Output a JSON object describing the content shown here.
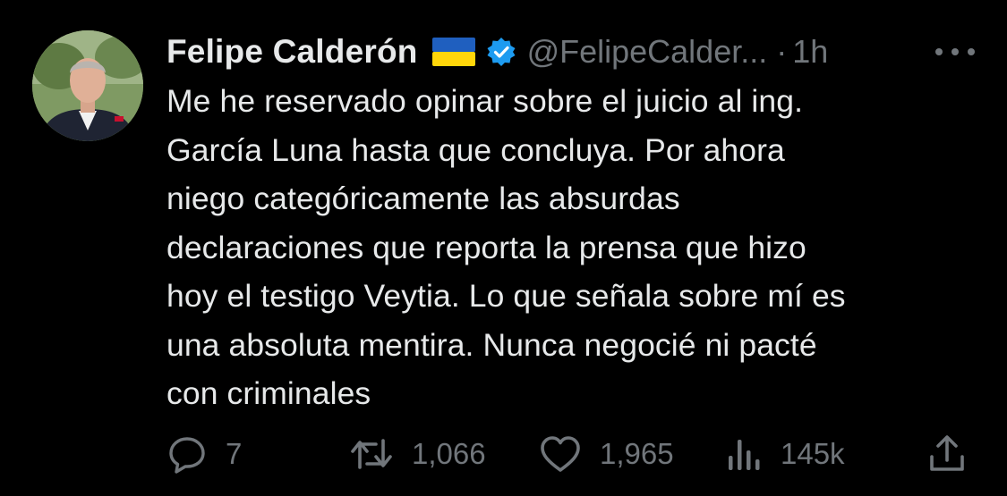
{
  "tweet": {
    "author_name": "Felipe Calderón",
    "handle": "@FelipeCalder...",
    "separator": "·",
    "time": "1h",
    "text": "Me he reservado opinar sobre el juicio al ing.\nGarcía Luna hasta que concluya. Por ahora\nniego categóricamente las absurdas\ndeclaraciones que reporta la prensa que hizo\nhoy el testigo Veytia.  Lo que señala sobre mí es\nuna absoluta mentira. Nunca negocié ni pacté\ncon criminales",
    "badges": [
      "ukraine-flag",
      "verified-badge-icon"
    ]
  },
  "actions": {
    "reply": {
      "icon": "reply-icon",
      "count": "7"
    },
    "retweet": {
      "icon": "retweet-icon",
      "count": "1,066"
    },
    "like": {
      "icon": "heart-icon",
      "count": "1,965"
    },
    "views": {
      "icon": "views-icon",
      "count": "145k"
    },
    "share": {
      "icon": "share-icon"
    }
  },
  "colors": {
    "background": "#000000",
    "text": "#e7e9ea",
    "muted": "#71767b",
    "verified": "#1d9bf0",
    "flag_blue": "#1f5fbf",
    "flag_yellow": "#ffd60a"
  }
}
